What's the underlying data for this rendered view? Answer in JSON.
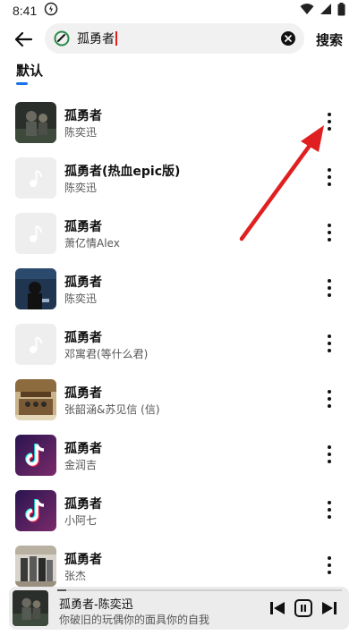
{
  "status_bar": {
    "time": "8:41",
    "icons": [
      "sync-icon",
      "wifi-icon",
      "signal-icon",
      "battery-icon"
    ]
  },
  "search": {
    "query": "孤勇者",
    "submit_label": "搜索",
    "back_icon": "back-arrow-icon",
    "clear_icon": "clear-icon"
  },
  "tabs": [
    {
      "label": "默认",
      "active": true
    }
  ],
  "accent_color": "#1a73e8",
  "songs": [
    {
      "title": "孤勇者",
      "artist": "陈奕迅",
      "cover": "album-art-dark"
    },
    {
      "title": "孤勇者(热血epic版)",
      "artist": "陈奕迅",
      "cover": "music-note-placeholder"
    },
    {
      "title": "孤勇者",
      "artist": "萧亿情Alex",
      "cover": "music-note-placeholder"
    },
    {
      "title": "孤勇者",
      "artist": "陈奕迅",
      "cover": "album-art-blue"
    },
    {
      "title": "孤勇者",
      "artist": "邓寓君(等什么君)",
      "cover": "music-note-placeholder"
    },
    {
      "title": "孤勇者",
      "artist": "张韶涵&苏见信 (信)",
      "cover": "album-art-stage"
    },
    {
      "title": "孤勇者",
      "artist": "金润吉",
      "cover": "tiktok-logo"
    },
    {
      "title": "孤勇者",
      "artist": "小阿七",
      "cover": "tiktok-logo"
    },
    {
      "title": "孤勇者",
      "artist": "张杰",
      "cover": "album-art-group"
    }
  ],
  "player": {
    "title": "孤勇者-陈奕迅",
    "lyric": "你破旧的玩偶你的面具你的自我",
    "progress": 0.03,
    "controls": [
      "previous-icon",
      "pause-icon",
      "next-icon"
    ]
  },
  "annotation": {
    "color": "#e02020",
    "target": "more-options-button"
  }
}
